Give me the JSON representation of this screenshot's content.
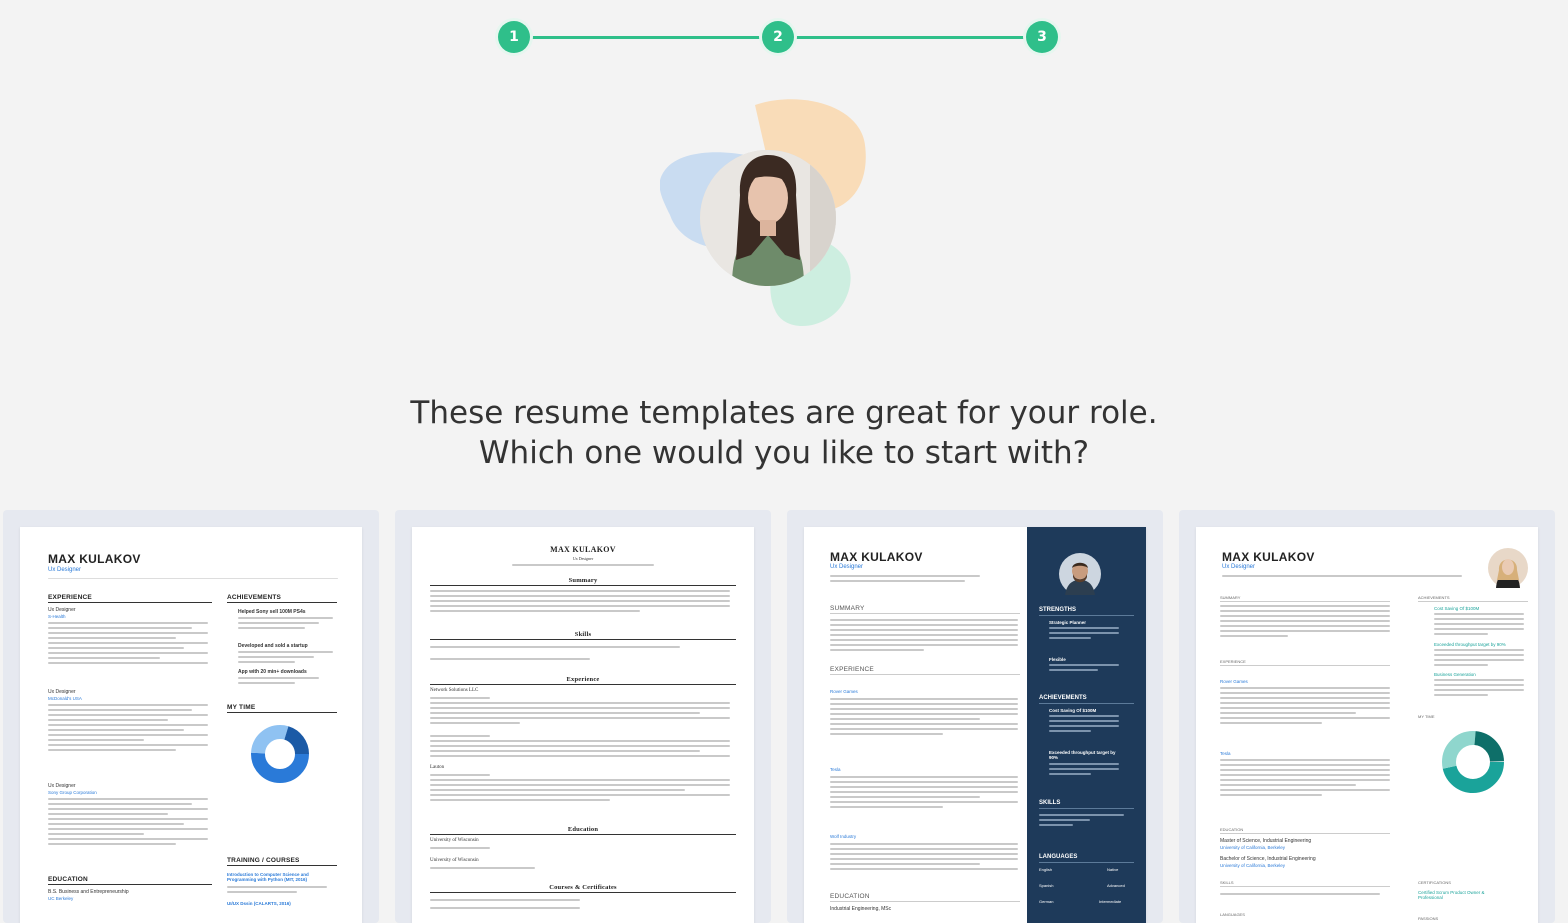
{
  "stepper": {
    "steps": [
      "1",
      "2",
      "3"
    ],
    "accent": "#2fbf8a"
  },
  "headline": {
    "line1": "These resume templates are great for your role.",
    "line2": "Which one would you like to start with?"
  },
  "templates": [
    {
      "name": "MAX KULAKOV",
      "role": "Ux Designer",
      "sections": {
        "experience": "EXPERIENCE",
        "achievements": "ACHIEVEMENTS",
        "my_time": "MY TIME",
        "training": "TRAINING / COURSES",
        "education": "EDUCATION"
      },
      "jobs": [
        "Ux Designer",
        "Ux Designer",
        "Ux Designer"
      ],
      "companies": [
        "S-Health",
        "McDonald's USA",
        "Sony Group Corporation"
      ],
      "achievements": [
        "Helped Sony sell 100M PS4s",
        "Developed and sold a startup",
        "App with 20 min+ downloads"
      ],
      "training": [
        "Introduction to Computer Science and Programming with Python (MIT, 2016)",
        "UI/UX Dssin (CALARTS, 2016)"
      ],
      "education": "B.S. Business and Entrepreneurship",
      "school": "UC Berkeley"
    },
    {
      "name": "MAX KULAKOV",
      "role": "Ux Designer",
      "sections": {
        "summary": "Summary",
        "skills": "Skills",
        "experience": "Experience",
        "education": "Education",
        "courses": "Courses & Certificates"
      },
      "companies": [
        "Network Solutions LLC",
        "Lauton"
      ],
      "schools": [
        "University of Wisconsin",
        "University of Wisconsin"
      ]
    },
    {
      "name": "MAX KULAKOV",
      "role": "Ux Designer",
      "sections": {
        "summary": "SUMMARY",
        "experience": "EXPERIENCE",
        "education": "EDUCATION",
        "strengths": "STRENGTHS",
        "achievements": "ACHIEVEMENTS",
        "skills": "SKILLS",
        "languages": "LANGUAGES"
      },
      "companies": [
        "Rover Games",
        "Tesla",
        "Wolf Industry"
      ],
      "strengths": [
        "Strategic Planner",
        "Flexible"
      ],
      "achievements": [
        "Cost Saving Of $100M",
        "Exceeded throughput target by 90%"
      ],
      "languages": [
        [
          "English",
          "Native"
        ],
        [
          "Spanish",
          "Advanced"
        ],
        [
          "German",
          "Intermediate"
        ]
      ],
      "education": "Industrial Engineering, MSc"
    },
    {
      "name": "MAX KULAKOV",
      "role": "Ux Designer",
      "sections": {
        "summary": "SUMMARY",
        "experience": "EXPERIENCE",
        "education": "EDUCATION",
        "skills": "SKILLS",
        "languages": "LANGUAGES",
        "achievements": "ACHIEVEMENTS",
        "my_time": "MY TIME",
        "certifications": "CERTIFICATIONS",
        "passions": "PASSIONS"
      },
      "companies": [
        "Rover Games",
        "Tesla"
      ],
      "education": [
        "Master of Science, Industrial Engineering",
        "Bachelor of Science, Industrial Engineering"
      ],
      "schools": [
        "University of California, Berkeley",
        "University of California, Berkeley"
      ],
      "achievements": [
        "Cost Saving Of $100M",
        "Exceeded throughput target by 90%",
        "Business Generation"
      ],
      "certification": "Certified Scrum Product Owner & Professional"
    }
  ]
}
